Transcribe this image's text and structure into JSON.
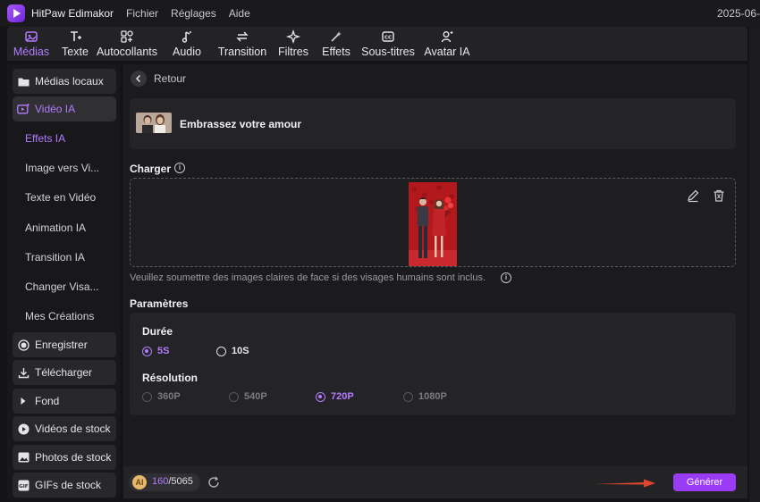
{
  "titlebar": {
    "app_name": "HitPaw Edimakor",
    "menu": [
      "Fichier",
      "Réglages",
      "Aide"
    ],
    "date": "2025-06-"
  },
  "toolbar": {
    "tools": [
      {
        "label": "Médias",
        "icon": "media-icon",
        "active": true
      },
      {
        "label": "Texte",
        "icon": "text-icon"
      },
      {
        "label": "Autocollants",
        "icon": "stickers-icon"
      },
      {
        "label": "Audio",
        "icon": "audio-icon"
      },
      {
        "label": "Transition",
        "icon": "transition-icon"
      },
      {
        "label": "Filtres",
        "icon": "filters-icon"
      },
      {
        "label": "Effets",
        "icon": "effects-icon"
      },
      {
        "label": "Sous-titres",
        "icon": "subtitles-icon"
      },
      {
        "label": "Avatar IA",
        "icon": "avatar-icon"
      }
    ]
  },
  "sidebar": {
    "local_media": "Médias locaux",
    "ai_video": "Vidéo IA",
    "sub_items": [
      "Effets IA",
      "Image vers Vi...",
      "Texte en Vidéo",
      "Animation IA",
      "Transition IA",
      "Changer Visa...",
      "Mes Créations"
    ],
    "bottom_items": [
      "Enregistrer",
      "Télécharger",
      "Fond",
      "Vidéos de stock",
      "Photos de stock",
      "GIFs de stock"
    ]
  },
  "main": {
    "back_label": "Retour",
    "effect_title": "Embrassez votre amour",
    "upload_label": "Charger",
    "hint": "Veuillez soumettre des images claires de face si des visages humains sont inclus.",
    "params_label": "Paramètres",
    "duration_label": "Durée",
    "durations": [
      {
        "label": "5S",
        "selected": true
      },
      {
        "label": "10S",
        "selected": false
      }
    ],
    "resolution_label": "Résolution",
    "resolutions": [
      {
        "label": "360P",
        "selected": false
      },
      {
        "label": "540P",
        "selected": false
      },
      {
        "label": "720P",
        "selected": true
      },
      {
        "label": "1080P",
        "selected": false
      }
    ]
  },
  "bottombar": {
    "credits_current": "160",
    "credits_total": "/5065",
    "generate_label": "Générer"
  },
  "colors": {
    "accent": "#b57bff",
    "button": "#9a3cf6",
    "arrow": "#e0452f"
  }
}
